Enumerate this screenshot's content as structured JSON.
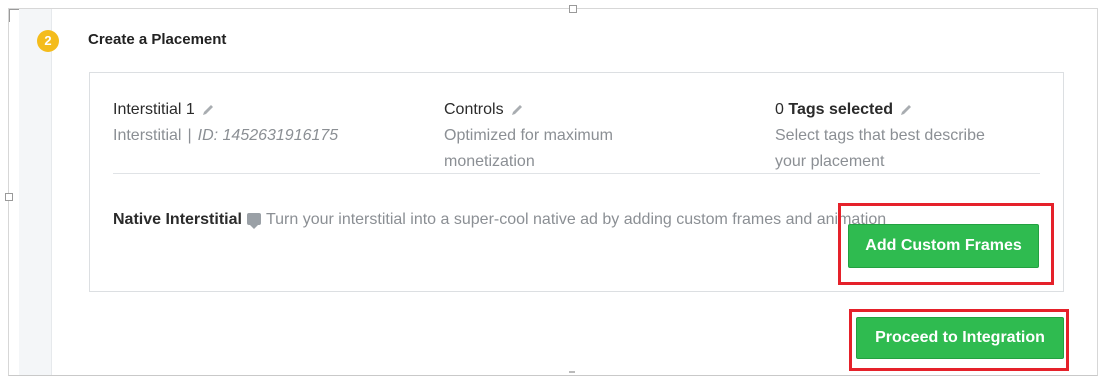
{
  "step": {
    "number": "2",
    "title": "Create a Placement"
  },
  "placement": {
    "name": "Interstitial 1",
    "type": "Interstitial",
    "separator": "|",
    "id_text": "ID: 1452631916175"
  },
  "controls": {
    "title": "Controls",
    "description_line1": "Optimized for maximum",
    "description_line2": "monetization"
  },
  "tags": {
    "count": "0",
    "title_suffix": "Tags selected",
    "description_line1": "Select tags that best describe",
    "description_line2": "your placement"
  },
  "native": {
    "label": "Native Interstitial",
    "description": "Turn your interstitial into a super-cool native ad by adding custom frames and animation"
  },
  "buttons": {
    "add_custom_frames": "Add Custom Frames",
    "proceed": "Proceed to Integration"
  },
  "colors": {
    "badge": "#f4bc1c",
    "button_green": "#2fbb50",
    "highlight_red": "#e5212a"
  }
}
